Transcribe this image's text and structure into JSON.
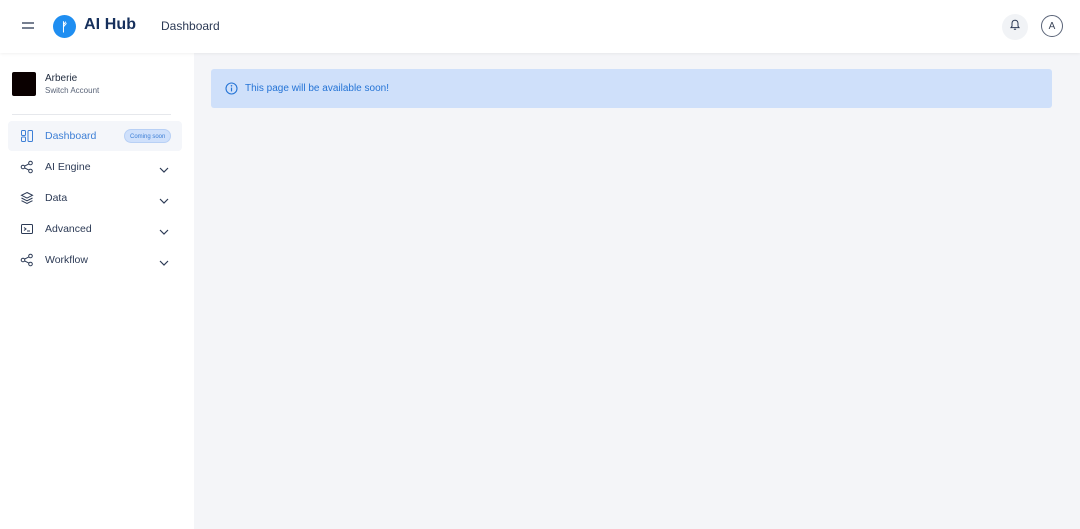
{
  "header": {
    "app_title": "AI Hub",
    "page_title": "Dashboard",
    "avatar_initial": "A",
    "logo_glyph": "ᚠ",
    "icons": {
      "menu": "hamburger-icon",
      "notifications": "bell-icon"
    }
  },
  "account": {
    "name": "Arberie",
    "switch_label": "Switch Account"
  },
  "sidebar": {
    "items": [
      {
        "label": "Dashboard",
        "icon": "grid-icon",
        "badge": "Coming soon",
        "active": true
      },
      {
        "label": "AI Engine",
        "icon": "share-nodes-icon",
        "expandable": true
      },
      {
        "label": "Data",
        "icon": "layers-icon",
        "expandable": true
      },
      {
        "label": "Advanced",
        "icon": "terminal-icon",
        "expandable": true
      },
      {
        "label": "Workflow",
        "icon": "share-nodes-icon",
        "expandable": true
      }
    ]
  },
  "main": {
    "alert_text": "This page will be available soon!"
  },
  "colors": {
    "accent": "#3d7fd6",
    "logo": "#1f8ef1",
    "alert_bg": "#cfe0fa",
    "alert_text": "#2574d6",
    "background": "#f4f5f8"
  }
}
